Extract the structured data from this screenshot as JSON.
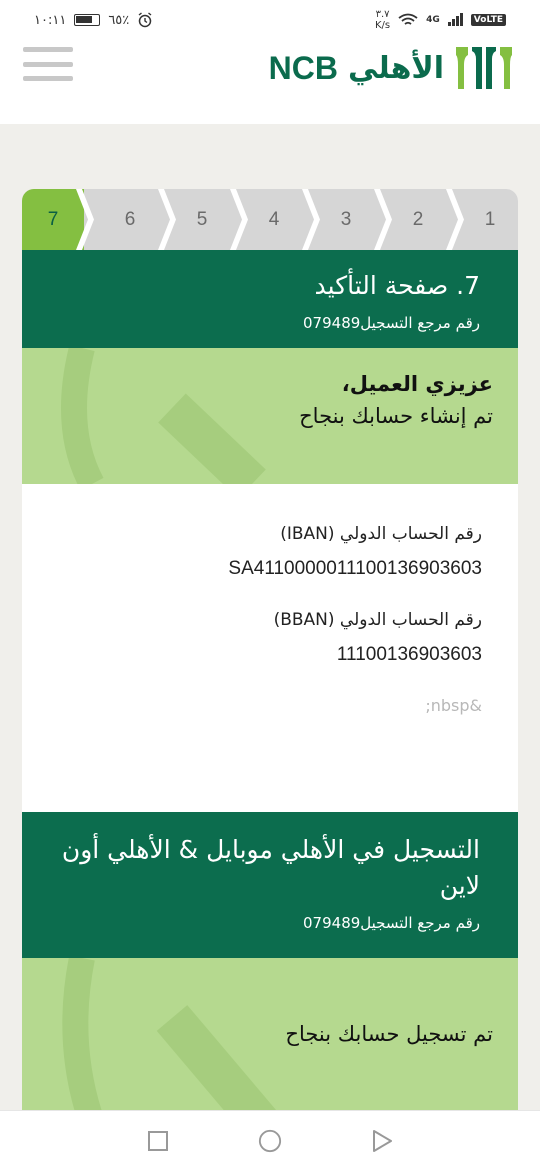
{
  "status_bar": {
    "time": "١٠:١١",
    "battery_percent": "٦٥٪",
    "network_speed_value": "٣.٧",
    "network_speed_unit": "K/s",
    "network": "4G",
    "volte": "VoLTE"
  },
  "header": {
    "logo_ar": "الأهلي",
    "logo_en": "NCB",
    "brand_color": "#0b6b4d"
  },
  "steps": {
    "items": [
      "7",
      "6",
      "5",
      "4",
      "3",
      "2",
      "1"
    ],
    "active": "7"
  },
  "confirmation": {
    "title": "7. صفحة التأكيد",
    "reference_label": "رقم مرجع التسجيل",
    "reference_value": "079489",
    "greeting": "عزيزي العميل،",
    "message": "تم إنشاء حسابك بنجاح"
  },
  "account_info": {
    "iban_label": "رقم الحساب الدولي (IBAN)",
    "iban_value": "SA4110000011100136903603",
    "bban_label": "رقم الحساب الدولي (BBAN)",
    "bban_value": "11100136903603",
    "placeholder_text": "&nbsp;"
  },
  "mobile_registration": {
    "title": "التسجيل في الأهلي موبايل & الأهلي أون لاين",
    "reference_label": "رقم مرجع التسجيل",
    "reference_value": "079489",
    "message": "تم تسجيل حسابك بنجاح"
  },
  "colors": {
    "dark_green": "#0c6d4e",
    "light_green": "#b5d98f",
    "active_step": "#84bf41"
  },
  "nav": {
    "icons": [
      "recent-apps-icon",
      "home-icon",
      "back-icon"
    ]
  }
}
